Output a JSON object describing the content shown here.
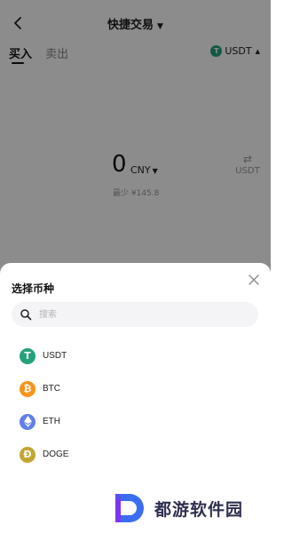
{
  "header": {
    "title": "快捷交易"
  },
  "tabs": [
    {
      "label": "买入",
      "active": true
    },
    {
      "label": "卖出",
      "active": false
    }
  ],
  "asset": {
    "symbol": "USDT",
    "icon": "tether-icon"
  },
  "amount": {
    "value": "0",
    "currency": "CNY",
    "minimum": "最少 ¥145.8"
  },
  "switch": {
    "label": "USDT",
    "icon": "swap-icon"
  },
  "sheet": {
    "title": "选择币种",
    "search_placeholder": "搜索",
    "coins": [
      {
        "name": "USDT",
        "icon": "tether-icon",
        "color": "#26a17b"
      },
      {
        "name": "BTC",
        "icon": "bitcoin-icon",
        "color": "#f7931a"
      },
      {
        "name": "ETH",
        "icon": "ethereum-icon",
        "color": "#627eea"
      },
      {
        "name": "DOGE",
        "icon": "dogecoin-icon",
        "color": "#c2a633"
      }
    ]
  },
  "watermark": {
    "text": "都游软件园"
  },
  "colors": {
    "overlay": "rgba(0,0,0,0.45)",
    "usdt_green": "#26a17b"
  }
}
